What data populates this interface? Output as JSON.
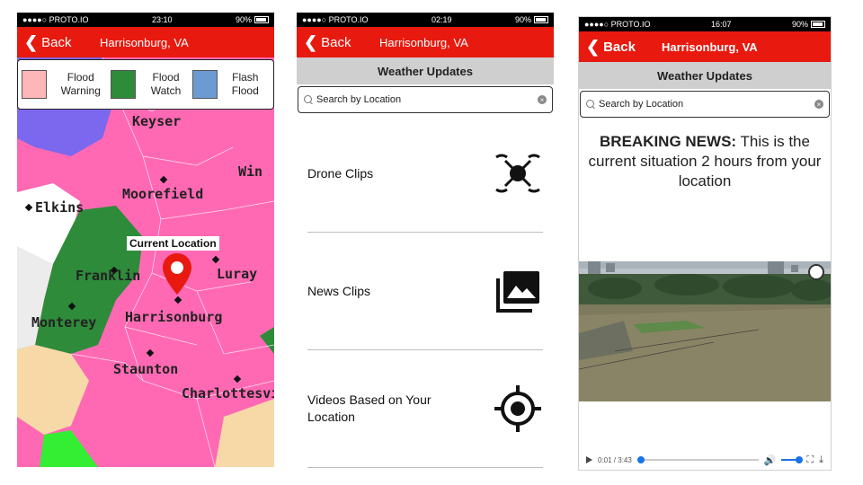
{
  "phones": [
    {
      "status": {
        "carrier": "●●●●○ PROTO.IO",
        "time": "23:10",
        "battery": "90%"
      },
      "nav": {
        "back": "Back",
        "title": "Harrisonburg, VA"
      },
      "legend": [
        {
          "label": "Flood Warning",
          "color": "#ffb6b9"
        },
        {
          "label": "Flood Watch",
          "color": "#2e8b3a"
        },
        {
          "label": "Flash Flood",
          "color": "#6b9bd1"
        }
      ],
      "map_labels": {
        "keyser": "Keyser",
        "moorefield": "Moorefield",
        "win": "Win",
        "elkins": "Elkins",
        "franklin": "Franklin",
        "luray": "Luray",
        "monterey": "Monterey",
        "harrisonburg": "Harrisonburg",
        "staunton": "Staunton",
        "charlottesville": "Charlottesvi"
      },
      "current_location": "Current Location"
    },
    {
      "status": {
        "carrier": "●●●●○ PROTO.IO",
        "time": "02:19",
        "battery": "90%"
      },
      "nav": {
        "back": "Back",
        "title": "Harrisonburg, VA"
      },
      "section": "Weather Updates",
      "search_placeholder": "Search by Location",
      "items": [
        {
          "label": "Drone Clips",
          "icon": "drone-icon"
        },
        {
          "label": "News Clips",
          "icon": "photo-library-icon"
        },
        {
          "label": "Videos Based on Your Location",
          "icon": "gps-target-icon"
        }
      ]
    },
    {
      "status": {
        "carrier": "●●●●○ PROTO.IO",
        "time": "16:07",
        "battery": "90%"
      },
      "nav": {
        "back": "Back",
        "title": "Harrisonburg, VA"
      },
      "section": "Weather Updates",
      "search_placeholder": "Search by Location",
      "breaking_label": "BREAKING NEWS:",
      "breaking_text": " This is the current situation 2 hours from your location",
      "video": {
        "time": "0:01 / 3:43",
        "progress": 0.0,
        "volume": 1.0
      }
    }
  ]
}
